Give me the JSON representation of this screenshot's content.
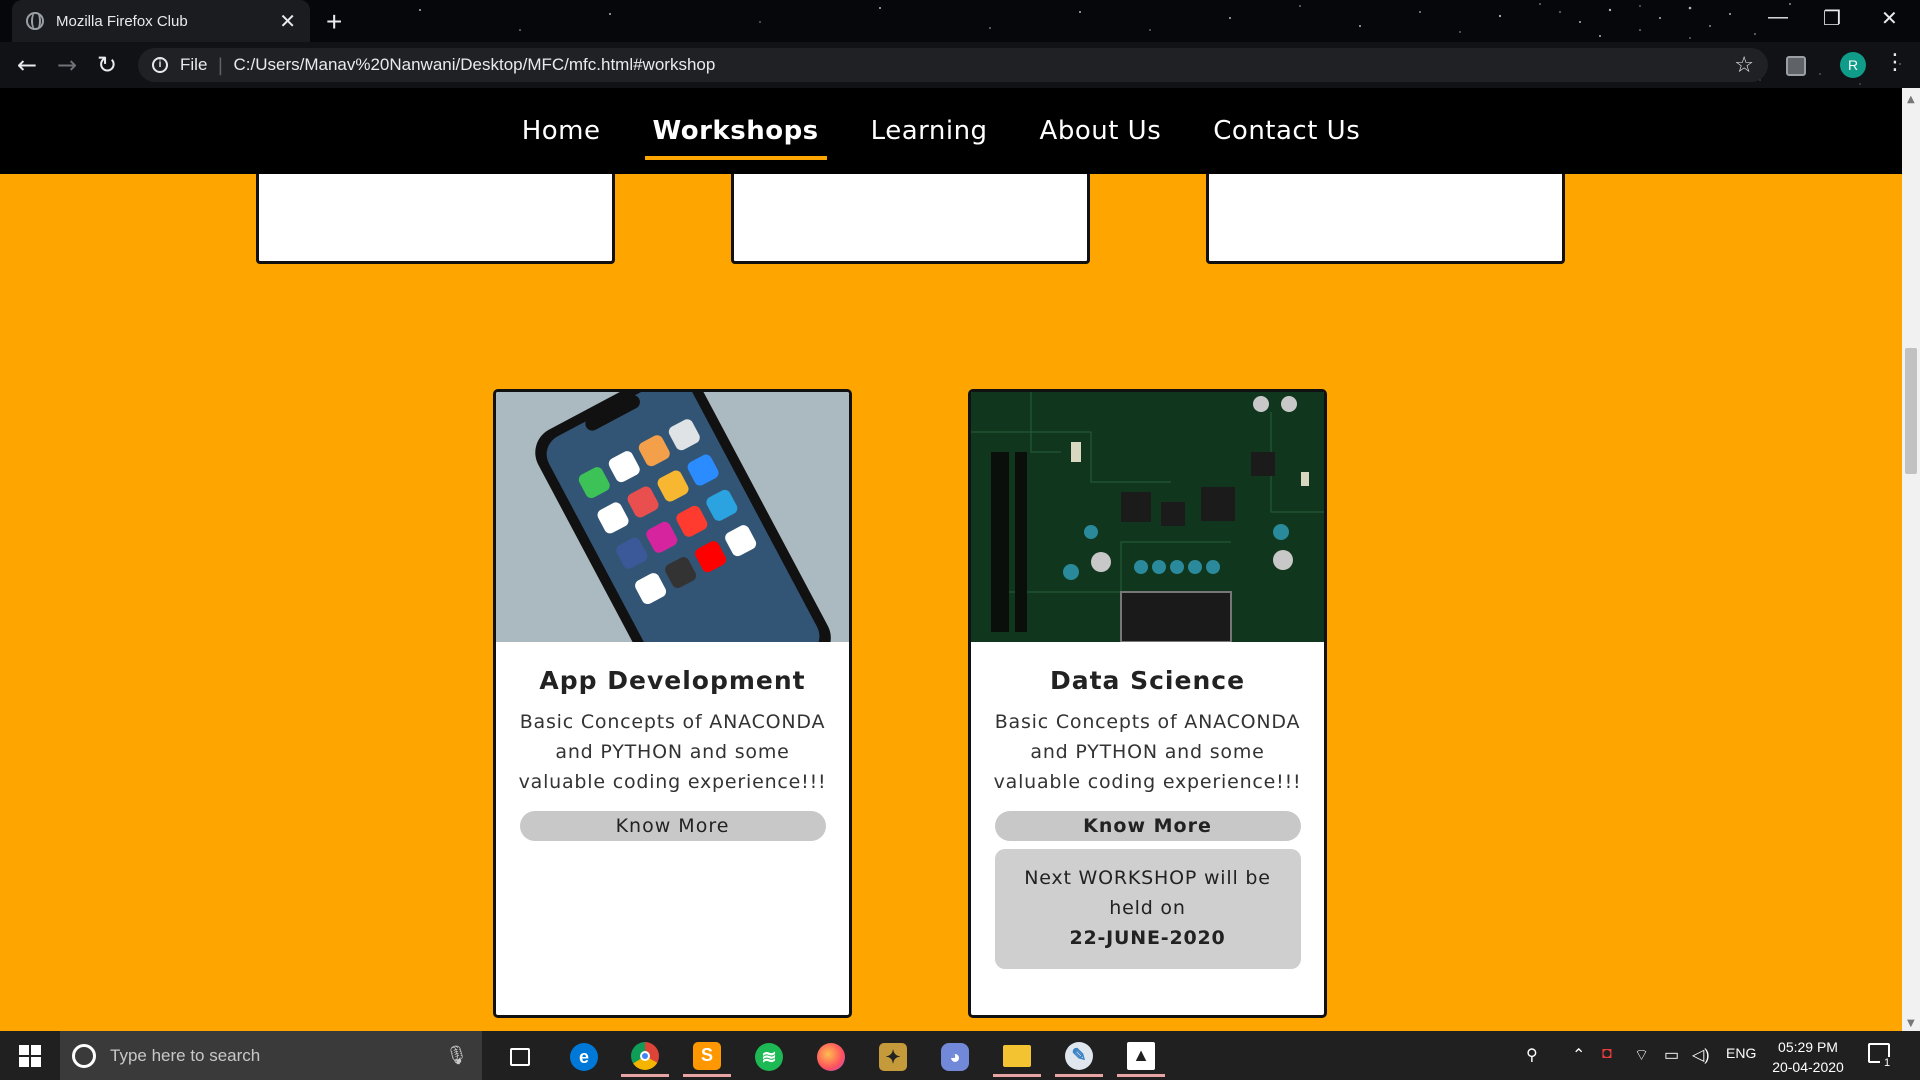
{
  "browser": {
    "tab_title": "Mozilla Firefox Club",
    "tab_close": "✕",
    "new_tab": "+",
    "url_scheme": "File",
    "url": "C:/Users/Manav%20Nanwani/Desktop/MFC/mfc.html#workshop",
    "window_controls": {
      "minimize": "—",
      "restore": "❐",
      "close": "✕"
    }
  },
  "site_nav": {
    "items": [
      {
        "label": "Home"
      },
      {
        "label": "Workshops",
        "active": true
      },
      {
        "label": "Learning"
      },
      {
        "label": "About Us"
      },
      {
        "label": "Contact Us"
      }
    ]
  },
  "cards": [
    {
      "title": "App Development",
      "description": "Basic Concepts of ANACONDA and PYTHON and some valuable coding experience!!!",
      "button": "Know More",
      "image_icon": "smartphone-photo"
    },
    {
      "title": "Data Science",
      "description": "Basic Concepts of ANACONDA and PYTHON and some valuable coding experience!!!",
      "button": "Know More",
      "image_icon": "circuit-board-photo",
      "info": {
        "text": "Next WORKSHOP will be held on",
        "date": "22-JUNE-2020"
      }
    }
  ],
  "taskbar": {
    "search_placeholder": "Type here to search",
    "tray_lang": "ENG",
    "time": "05:29 PM",
    "date": "20-04-2020",
    "notification_count": "1"
  },
  "colors": {
    "page_background": "#ffa500",
    "nav_background": "#000000",
    "active_underline": "#ffa500",
    "card_button": "#c8c8c8"
  }
}
